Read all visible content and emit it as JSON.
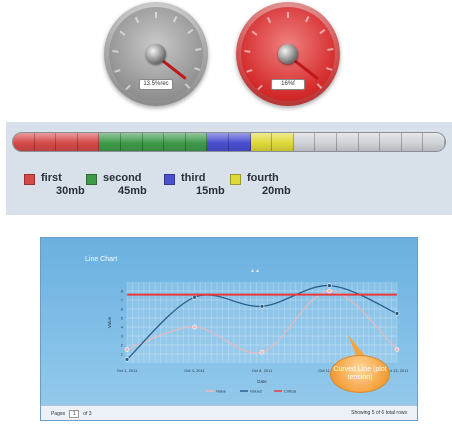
{
  "gauges": [
    {
      "readout": "13.5%rec",
      "color": "#8e8e8e"
    },
    {
      "readout": "16%f",
      "color": "#d42a2a"
    }
  ],
  "storage": {
    "segments": [
      {
        "count": 4,
        "color": "#d64a4a"
      },
      {
        "count": 5,
        "color": "#3f9a4a"
      },
      {
        "count": 2,
        "color": "#4b4fd0"
      },
      {
        "count": 2,
        "color": "#e0d93a"
      },
      {
        "count": 7,
        "color": "#cfd3d7"
      }
    ],
    "legend": [
      {
        "name": "first",
        "size": "30mb",
        "color": "#d64a4a"
      },
      {
        "name": "second",
        "size": "45mb",
        "color": "#3f9a4a"
      },
      {
        "name": "third",
        "size": "15mb",
        "color": "#4b4fd0"
      },
      {
        "name": "fourth",
        "size": "20mb",
        "color": "#e0d93a"
      }
    ]
  },
  "chart_panel": {
    "title": "Line Chart",
    "top_tag": "▲▲",
    "pager_label": "Pages",
    "page_current": "1",
    "page_of": "of 3",
    "summary": "Showing 5 of 6 total rows",
    "callout": "Curved Line (plot tension)"
  },
  "chart_data": {
    "type": "line",
    "xlabel": "Date",
    "ylabel": "Value",
    "x": [
      "Oct 1, 2011",
      "Oct 4, 2011",
      "Oct 8, 2011",
      "Oct 11, 2011",
      "Oct 13, 2011"
    ],
    "ylim": [
      0,
      9
    ],
    "yticks": [
      1,
      2,
      3,
      4,
      5,
      6,
      7,
      8
    ],
    "series": [
      {
        "name": "Value",
        "color": "#f2b7b7",
        "values": [
          1.5,
          4.0,
          1.2,
          8.0,
          1.5
        ]
      },
      {
        "name": "Value2",
        "color": "#2a5f8c",
        "values": [
          0.4,
          7.3,
          6.3,
          8.6,
          5.5
        ]
      },
      {
        "name": "Critical",
        "color": "#e83a3a",
        "values": [
          7.6,
          7.6,
          7.6,
          7.6,
          7.6
        ]
      }
    ]
  }
}
